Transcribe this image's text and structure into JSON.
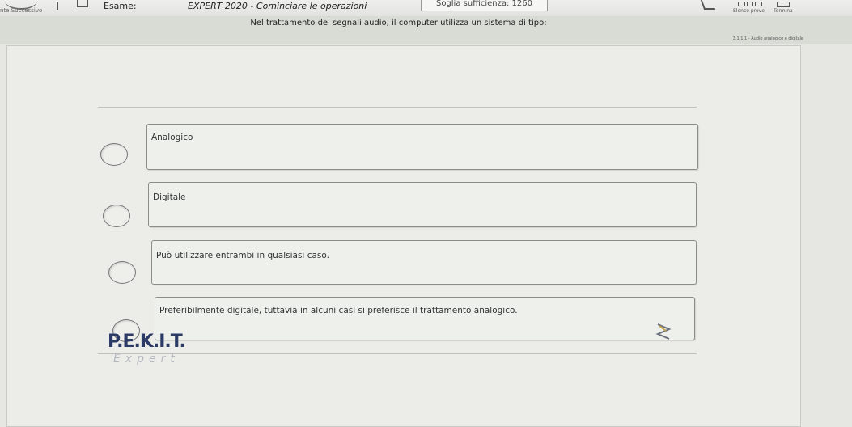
{
  "toolbar": {
    "nav_label": "nte  Successivo",
    "exam_label": "Esame:",
    "exam_title": "EXPERT 2020 - Cominciare le operazioni",
    "threshold": "Soglia sufficienza: 1260",
    "list_label": "Elenco prove",
    "end_label": "Termina"
  },
  "question": {
    "text": "Nel trattamento dei segnali audio, il computer utilizza un sistema di tipo:",
    "topic_code": "3.1.1.1 - Audio analogico e digitale"
  },
  "answers": [
    {
      "label": "Analogico"
    },
    {
      "label": "Digitale"
    },
    {
      "label": "Può utilizzare entrambi in qualsiasi caso."
    },
    {
      "label": "Preferibilmente digitale, tuttavia in alcuni casi si preferisce il trattamento analogico."
    }
  ],
  "brand": {
    "logo": "P.E.K.I.T.",
    "sub": "Expert"
  },
  "colors": {
    "logo": "#2c3a66",
    "background": "#e6e7e2"
  }
}
